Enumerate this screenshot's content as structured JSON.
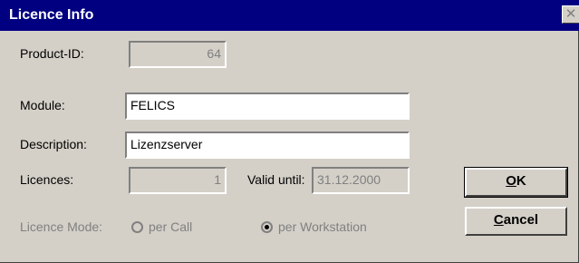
{
  "window": {
    "title": "Licence Info",
    "close_glyph": "✕"
  },
  "fields": {
    "product_id": {
      "label": "Product-ID:",
      "value": "64"
    },
    "module": {
      "label": "Module:",
      "value": "FELICS"
    },
    "description": {
      "label": "Description:",
      "value": "Lizenzserver"
    },
    "licences": {
      "label": "Licences:",
      "value": "1"
    },
    "valid_until": {
      "label": "Valid until:",
      "value": "31.12.2000"
    }
  },
  "licence_mode": {
    "label": "Licence Mode:",
    "options": [
      {
        "label": "per Call",
        "selected": false
      },
      {
        "label": "per Workstation",
        "selected": true
      }
    ]
  },
  "buttons": {
    "ok": {
      "mnemonic": "O",
      "rest": "K"
    },
    "cancel": {
      "mnemonic": "C",
      "rest": "ancel"
    }
  }
}
